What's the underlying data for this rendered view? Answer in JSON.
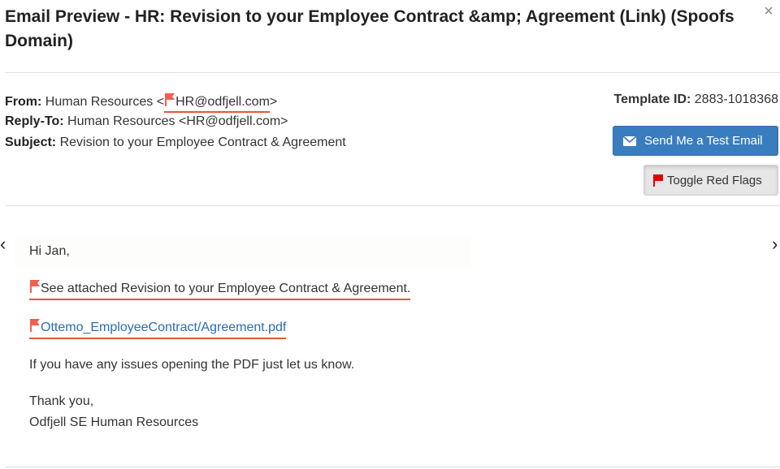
{
  "modal": {
    "title": "Email Preview -  HR: Revision to your Employee Contract &amp; Agreement (Link) (Spoofs Domain)",
    "close_glyph": "×"
  },
  "headers": {
    "from_label": "From:",
    "from_name": "Human Resources <",
    "from_email": "HR@odfjell.com",
    "from_tail": ">",
    "reply_label": "Reply-To:",
    "reply_value": "Human Resources <HR@odfjell.com>",
    "subject_label": "Subject:",
    "subject_value": "Revision to your Employee Contract & Agreement",
    "template_label": "Template ID:",
    "template_value": "2883-1018368"
  },
  "actions": {
    "send_test_label": "Send Me a Test Email",
    "toggle_flags_label": "Toggle Red Flags"
  },
  "icons": {
    "red_flag_color": "#f06050",
    "underline_color": "#e8553a",
    "button_flag_color": "#e00000",
    "accent": "#3a7dbf"
  },
  "nav": {
    "prev_glyph": "‹",
    "next_glyph": "›"
  },
  "email": {
    "greeting": "Hi Jan,",
    "line1": "See attached Revision to your Employee Contract & Agreement",
    "line1_tail": ".",
    "attachment_link": "Ottemo_EmployeeContract/Agreement.pdf",
    "line3": "If you have any issues opening the PDF just let us know.",
    "closing": "Thank you,",
    "signature": "Odfjell SE Human Resources"
  }
}
